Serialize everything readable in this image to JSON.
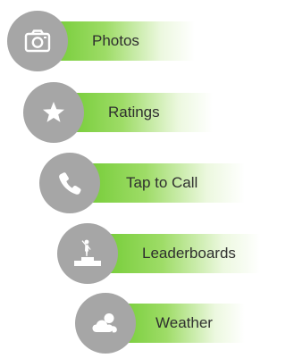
{
  "accent_green": "#6cc92d",
  "circle_color": "#a6a6a6",
  "items": [
    {
      "label": "Photos",
      "icon": "camera-icon"
    },
    {
      "label": "Ratings",
      "icon": "star-icon"
    },
    {
      "label": "Tap to Call",
      "icon": "phone-icon"
    },
    {
      "label": "Leaderboards",
      "icon": "leaderboard-podium-icon"
    },
    {
      "label": "Weather",
      "icon": "weather-cloud-sun-icon"
    }
  ]
}
